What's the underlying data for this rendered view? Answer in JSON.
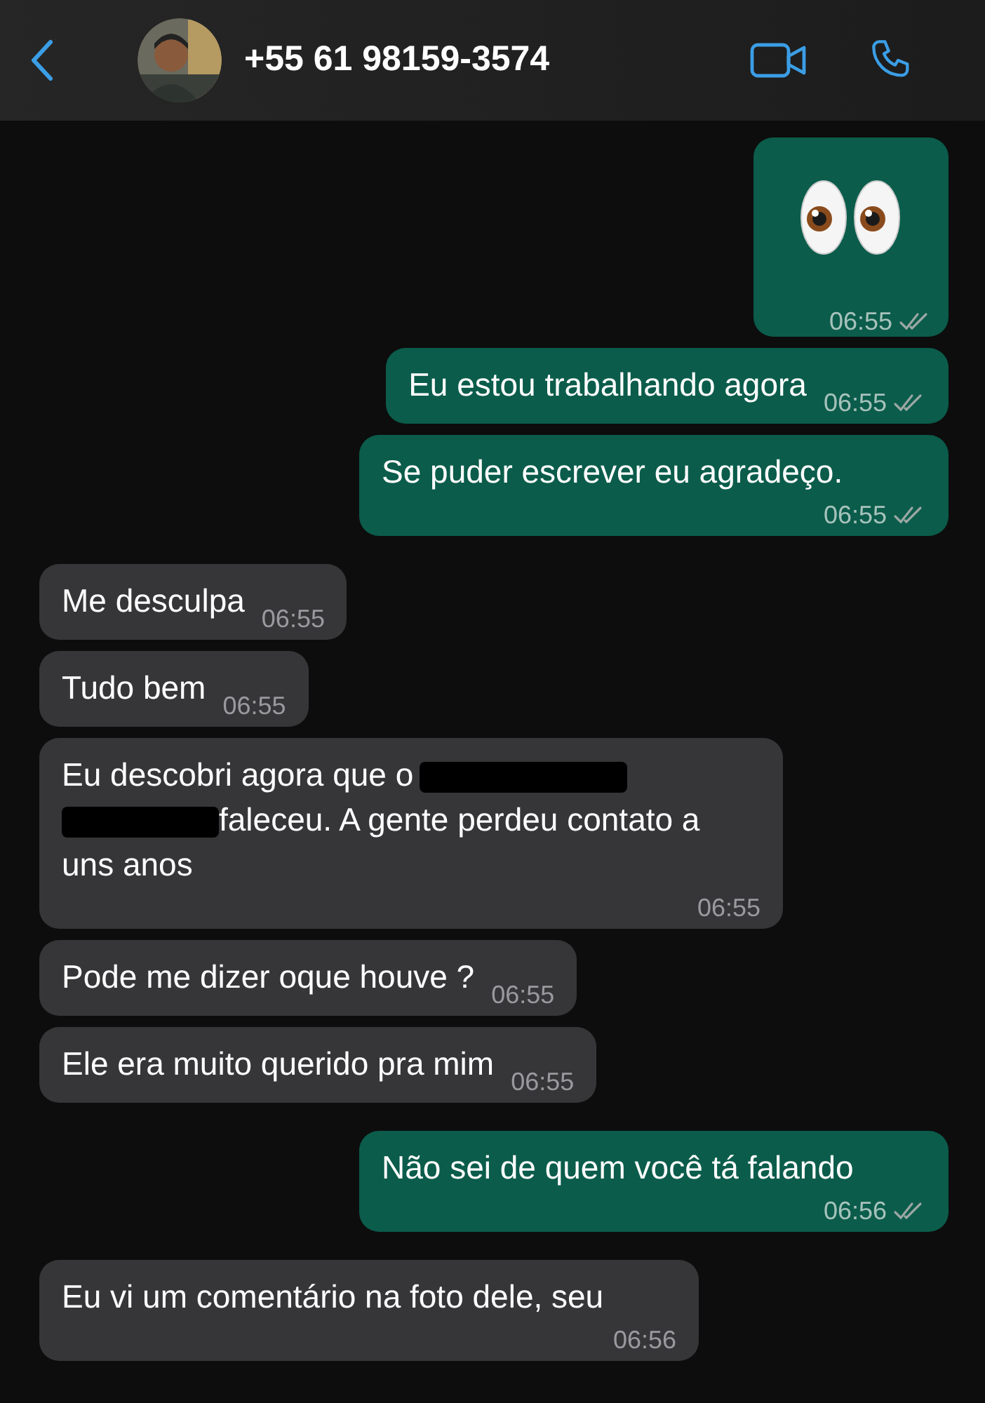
{
  "header": {
    "contact": "+55 61 98159-3574"
  },
  "messages": [
    {
      "outgoing": true,
      "kind": "jumbo_emoji",
      "time": "06:55",
      "delivered": true
    },
    {
      "outgoing": true,
      "kind": "text",
      "text": "Eu estou trabalhando agora",
      "time": "06:55",
      "delivered": true
    },
    {
      "outgoing": true,
      "kind": "text",
      "text": "Se puder escrever eu agradeço.",
      "time": "06:55",
      "delivered": true
    },
    {
      "outgoing": false,
      "kind": "text",
      "text": "Me desculpa",
      "time": "06:55"
    },
    {
      "outgoing": false,
      "kind": "text",
      "text": "Tudo bem",
      "time": "06:55"
    },
    {
      "outgoing": false,
      "kind": "redacted",
      "parts": [
        {
          "kind": "text",
          "text": "Eu descobri agora que o"
        },
        {
          "kind": "redaction"
        },
        {
          "kind": "redaction"
        },
        {
          "kind": "text",
          "text": "faleceu. A gente perdeu contato a uns anos"
        }
      ],
      "time": "06:55"
    },
    {
      "outgoing": false,
      "kind": "text",
      "text": "Pode me dizer oque houve ?",
      "time": "06:55"
    },
    {
      "outgoing": false,
      "kind": "text",
      "text": "Ele era muito querido pra mim",
      "time": "06:55"
    },
    {
      "outgoing": true,
      "kind": "text",
      "text": "Não sei de quem você tá falando",
      "time": "06:56",
      "delivered": true
    },
    {
      "outgoing": false,
      "kind": "text",
      "text": "Eu vi um comentário na foto dele, seu",
      "time": "06:56"
    }
  ]
}
